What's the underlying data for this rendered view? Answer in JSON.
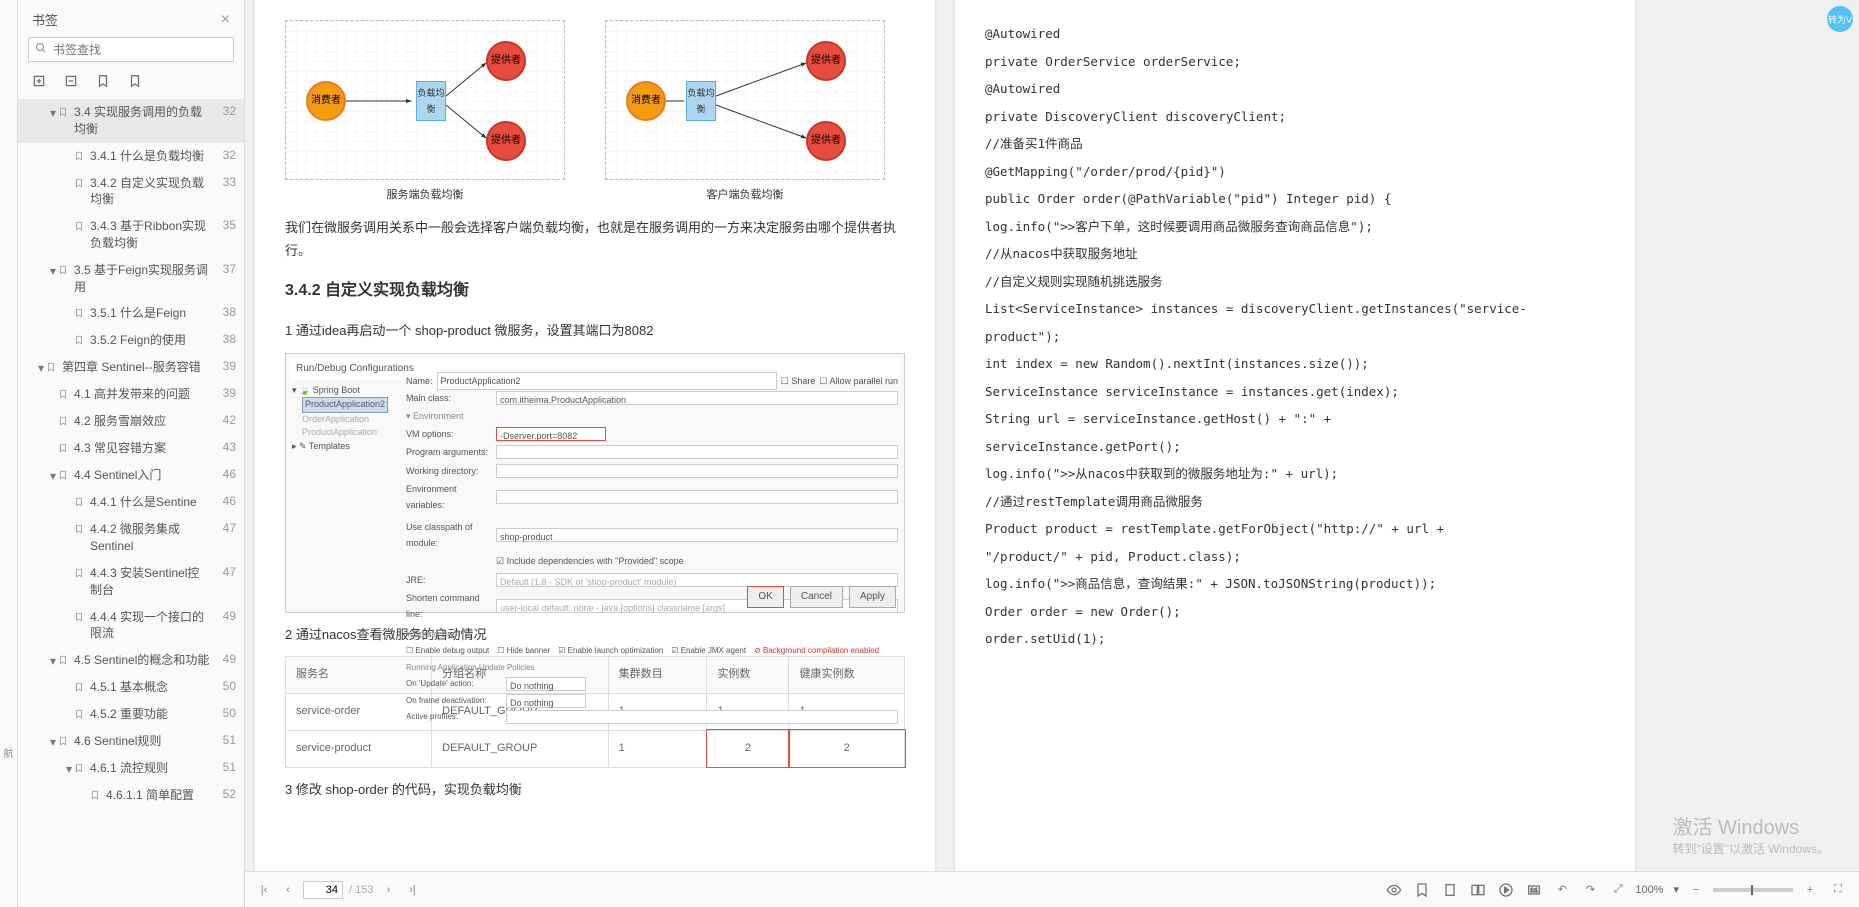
{
  "sidebar": {
    "title": "书签",
    "search_placeholder": "书签查找",
    "items": [
      {
        "label": "3.4 实现服务调用的负载均衡",
        "page": "32",
        "level": 2,
        "caret": true,
        "selected": true
      },
      {
        "label": "3.4.1 什么是负载均衡",
        "page": "32",
        "level": 3
      },
      {
        "label": "3.4.2 自定义实现负载均衡",
        "page": "33",
        "level": 3
      },
      {
        "label": "3.4.3 基于Ribbon实现负载均衡",
        "page": "35",
        "level": 3
      },
      {
        "label": "3.5 基于Feign实现服务调用",
        "page": "37",
        "level": 2,
        "caret": true
      },
      {
        "label": "3.5.1 什么是Feign",
        "page": "38",
        "level": 3
      },
      {
        "label": "3.5.2 Feign的使用",
        "page": "38",
        "level": 3
      },
      {
        "label": "第四章 Sentinel--服务容错",
        "page": "39",
        "level": 1,
        "caret": true
      },
      {
        "label": "4.1 高并发带来的问题",
        "page": "39",
        "level": 2
      },
      {
        "label": "4.2 服务雪崩效应",
        "page": "42",
        "level": 2
      },
      {
        "label": "4.3 常见容错方案",
        "page": "43",
        "level": 2
      },
      {
        "label": "4.4 Sentinel入门",
        "page": "46",
        "level": 2,
        "caret": true
      },
      {
        "label": "4.4.1 什么是Sentine",
        "page": "46",
        "level": 3
      },
      {
        "label": "4.4.2 微服务集成Sentinel",
        "page": "47",
        "level": 3
      },
      {
        "label": "4.4.3 安装Sentinel控制台",
        "page": "47",
        "level": 3
      },
      {
        "label": "4.4.4 实现一个接口的限流",
        "page": "49",
        "level": 3
      },
      {
        "label": "4.5 Sentinel的概念和功能",
        "page": "49",
        "level": 2,
        "caret": true
      },
      {
        "label": "4.5.1 基本概念",
        "page": "50",
        "level": 3
      },
      {
        "label": "4.5.2 重要功能",
        "page": "50",
        "level": 3
      },
      {
        "label": "4.6 Sentinel规则",
        "page": "51",
        "level": 2,
        "caret": true
      },
      {
        "label": "4.6.1 流控规则",
        "page": "51",
        "level": 3,
        "caret": true
      },
      {
        "label": "4.6.1.1 简单配置",
        "page": "52",
        "level": 4
      }
    ]
  },
  "bottom": {
    "nav_label": "航",
    "current_page": "34",
    "total_pages": "/ 153",
    "zoom": "100%"
  },
  "left_page": {
    "diagram": {
      "consumer": "消费者",
      "provider": "提供者",
      "lb": "负载均衡",
      "caption_server": "服务端负载均衡",
      "caption_client": "客户端负载均衡"
    },
    "p1": "我们在微服务调用关系中一般会选择客户端负载均衡，也就是在服务调用的一方来决定服务由哪个提供者执行。",
    "h342": "3.4.2 自定义实现负载均衡",
    "step1": "1 通过idea再启动一个 shop-product 微服务，设置其端口为8082",
    "config": {
      "title": "Run/Debug Configurations",
      "name_lbl": "Name:",
      "name_val": "ProductApplication2",
      "share": "Share",
      "allow_parallel": "Allow parallel run",
      "tree_root": "Spring Boot",
      "tree_sel": "ProductApplication2",
      "tree_item2": "OrderApplication",
      "tree_item3": "ProductApplication",
      "tree_templates": "Templates",
      "main_class_lbl": "Main class:",
      "main_class_val": "com.itheima.ProductApplication",
      "env_lbl": "Environment",
      "vm_lbl": "VM options:",
      "vm_val": "-Dserver.port=8082",
      "prog_args_lbl": "Program arguments:",
      "work_dir_lbl": "Working directory:",
      "env_vars_lbl": "Environment variables:",
      "classpath_lbl": "Use classpath of module:",
      "classpath_val": "shop-product",
      "include_deps": "Include dependencies with \"Provided\" scope",
      "jre_lbl": "JRE:",
      "jre_val": "Default (1.8 - SDK of 'shop-product' module)",
      "shorten_lbl": "Shorten command line:",
      "shorten_val": "user-local default: none - java [options] classname [args]",
      "spring_boot_section": "Spring Boot",
      "enable_debug": "Enable debug output",
      "hide_banner": "Hide banner",
      "enable_launch": "Enable launch optimization",
      "enable_jmx": "Enable JMX agent",
      "bg_compile": "Background compilation enabled",
      "update_policies": "Running Application Update Policies",
      "on_update_lbl": "On 'Update' action:",
      "do_nothing": "Do nothing",
      "on_frame_lbl": "On frame deactivation:",
      "active_profiles": "Active profiles:",
      "ok": "OK",
      "cancel": "Cancel",
      "apply": "Apply"
    },
    "step2": "2 通过nacos查看微服务的启动情况",
    "table": {
      "h1": "服务名",
      "h2": "分组名称",
      "h3": "集群数目",
      "h4": "实例数",
      "h5": "健康实例数",
      "r1": {
        "c1": "service-order",
        "c2": "DEFAULT_GROUP",
        "c3": "1",
        "c4": "1",
        "c5": "1"
      },
      "r2": {
        "c1": "service-product",
        "c2": "DEFAULT_GROUP",
        "c3": "1",
        "c4": "2",
        "c5": "2"
      }
    },
    "step3": "3 修改 shop-order 的代码，实现负载均衡"
  },
  "right_page": {
    "lines": [
      "@Autowired",
      "private OrderService orderService;",
      "@Autowired",
      "private DiscoveryClient discoveryClient;",
      "//准备买1件商品",
      "@GetMapping(\"/order/prod/{pid}\")",
      "public Order order(@PathVariable(\"pid\") Integer pid) {",
      "log.info(\">>客户下单，这时候要调用商品微服务查询商品信息\");",
      "//从nacos中获取服务地址",
      "//自定义规则实现随机挑选服务",
      "List<ServiceInstance> instances = discoveryClient.getInstances(\"service-",
      "product\");",
      "int index = new Random().nextInt(instances.size());",
      "ServiceInstance serviceInstance = instances.get(index);",
      "String url = serviceInstance.getHost() + \":\" +",
      "serviceInstance.getPort();",
      "log.info(\">>从nacos中获取到的微服务地址为:\" + url);",
      "//通过restTemplate调用商品微服务",
      "Product product = restTemplate.getForObject(\"http://\" + url +",
      "\"/product/\" + pid, Product.class);",
      "log.info(\">>商品信息，查询结果:\" + JSON.toJSONString(product));",
      "Order order = new Order();",
      "order.setUid(1);"
    ]
  },
  "win": {
    "t1": "激活 Windows",
    "t2": "转到\"设置\"以激活 Windows。"
  },
  "badge": "转为V"
}
